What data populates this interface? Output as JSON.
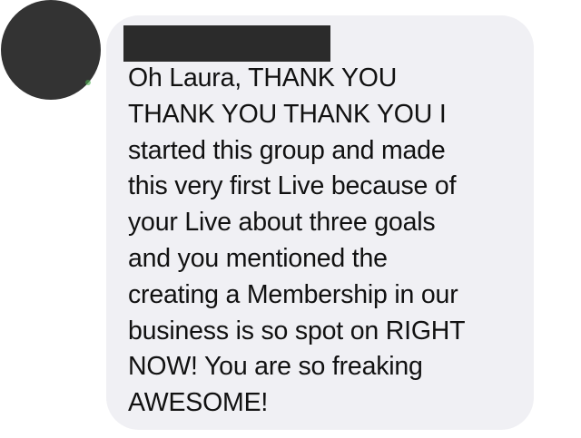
{
  "comment": {
    "author_name": "",
    "text": "Oh Laura, THANK YOU\nTHANK YOU  THANK YOU I\nstarted this group and made\nthis very first Live because of\nyour Live about three goals\nand you mentioned the\ncreating a Membership in our\nbusiness is so spot on RIGHT\nNOW! You are so freaking\nAWESOME!"
  },
  "colors": {
    "bubble_background": "#f0f0f4",
    "text": "#111111",
    "avatar": "#333333",
    "redaction": "#2b2b2b"
  }
}
